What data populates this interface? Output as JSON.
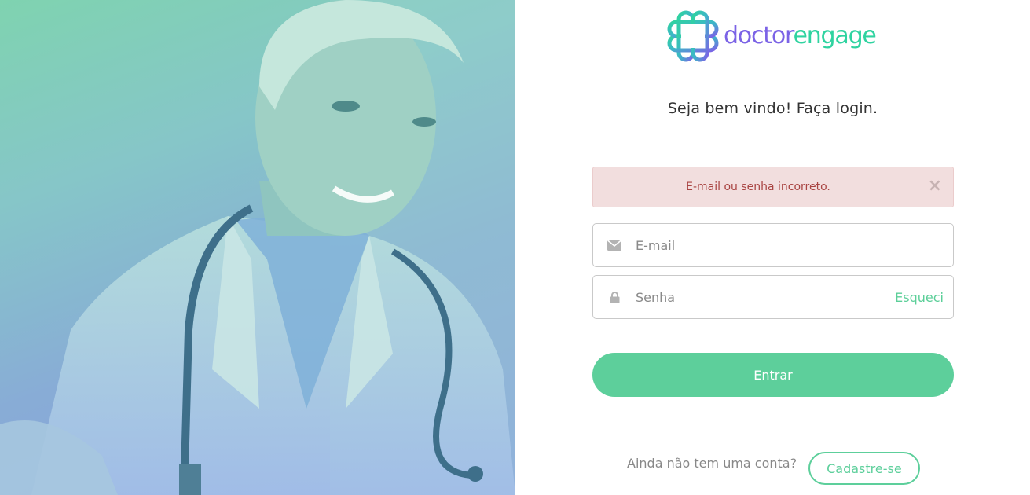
{
  "brand": {
    "word1": "doctor",
    "word2": "engage",
    "color1": "#7b63e6",
    "color2": "#2fd3a0"
  },
  "hero": {
    "image": "doctor-with-stethoscope-photo"
  },
  "login": {
    "welcome": "Seja bem vindo! Faça login.",
    "error": {
      "message": "E-mail ou senha incorreto.",
      "close": "×"
    },
    "email": {
      "placeholder": "E-mail",
      "value": "",
      "icon": "envelope-icon"
    },
    "password": {
      "placeholder": "Senha",
      "value": "",
      "icon": "lock-icon",
      "forgot_label": "Esqueci"
    },
    "submit_label": "Entrar",
    "signup_question": "Ainda não tem uma conta?",
    "signup_label": "Cadastre-se"
  },
  "colors": {
    "accent": "#5dcf9b",
    "alert_bg": "#f2dede",
    "alert_text": "#a94442"
  }
}
